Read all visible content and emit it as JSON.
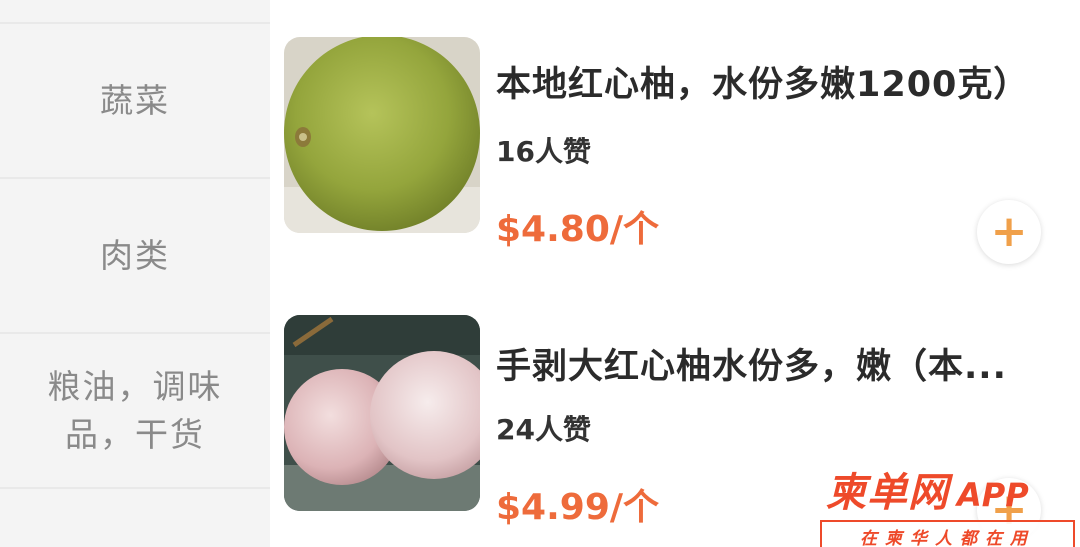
{
  "sidebar": {
    "categories": [
      {
        "label": "蔬菜"
      },
      {
        "label": "肉类"
      },
      {
        "label": "粮油，调味品，干货"
      },
      {
        "label": ""
      }
    ]
  },
  "products": [
    {
      "title": "本地红心柚，水份多嫩1200克）",
      "likes": "16人赞",
      "price": "$4.80/个",
      "add_label": "+"
    },
    {
      "title": "手剥大红心柚水份多，嫩（本...",
      "likes": "24人赞",
      "price": "$4.99/个",
      "add_label": "+"
    }
  ],
  "watermark": {
    "logo": "柬单网",
    "app": "APP",
    "slogan": "在柬华人都在用"
  },
  "colors": {
    "price": "#ee6b3b",
    "accent": "#f0a04a",
    "brand": "#ee4a2a"
  }
}
